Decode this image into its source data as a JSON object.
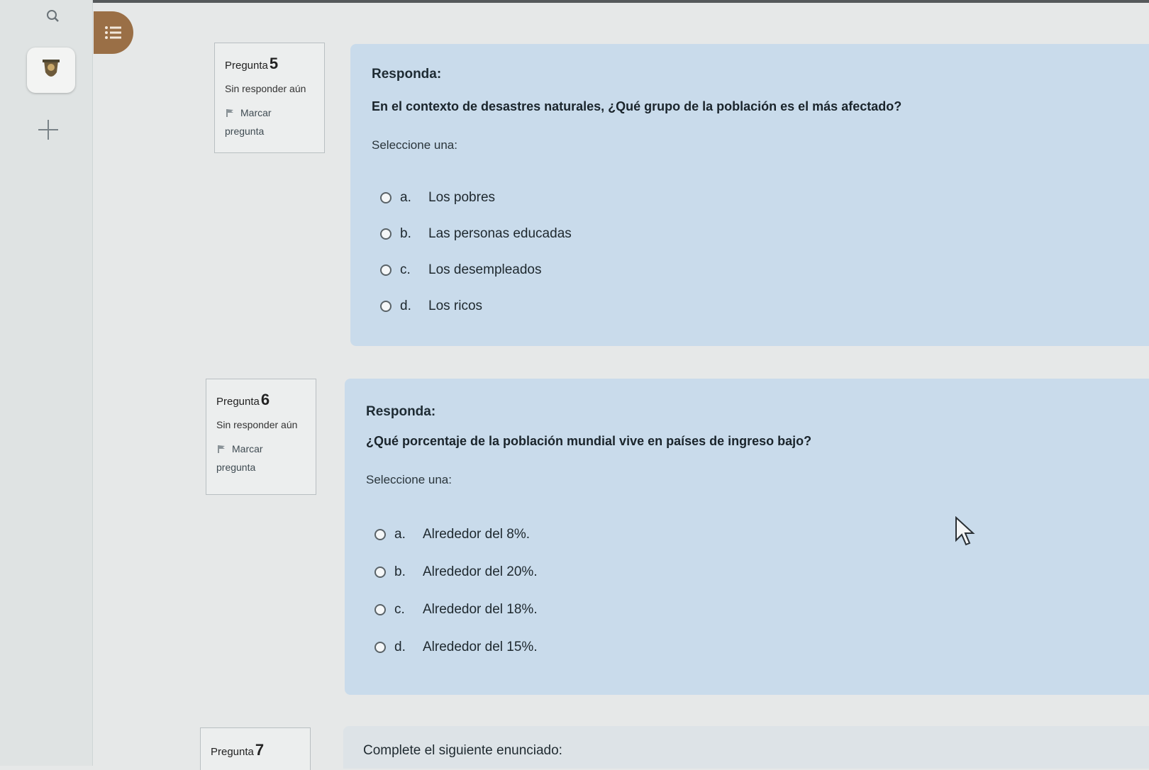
{
  "window": {
    "accent_color": "#9a6f46",
    "question_bg": "#c9dbeb"
  },
  "rail": {
    "search_icon": "search-icon",
    "logo_icon": "seal-icon",
    "add_icon": "plus-icon"
  },
  "menu": {
    "icon": "list-icon"
  },
  "questions": [
    {
      "label": "Pregunta",
      "number": "5",
      "status": "Sin responder aún",
      "flag_line1": "Marcar",
      "flag_line2": "pregunta",
      "responda": "Responda:",
      "text": "En el contexto de desastres naturales, ¿Qué grupo de la población es el más afectado?",
      "select_label": "Seleccione una:",
      "options": [
        {
          "letter": "a.",
          "text": "Los pobres"
        },
        {
          "letter": "b.",
          "text": "Las personas educadas"
        },
        {
          "letter": "c.",
          "text": "Los desempleados"
        },
        {
          "letter": "d.",
          "text": "Los ricos"
        }
      ]
    },
    {
      "label": "Pregunta",
      "number": "6",
      "status": "Sin responder aún",
      "flag_line1": "Marcar",
      "flag_line2": "pregunta",
      "responda": "Responda:",
      "text": "¿Qué porcentaje de la población mundial vive en países de ingreso bajo?",
      "select_label": "Seleccione una:",
      "options": [
        {
          "letter": "a.",
          "text": "Alrededor del 8%."
        },
        {
          "letter": "b.",
          "text": "Alrededor del 20%."
        },
        {
          "letter": "c.",
          "text": "Alrededor del 18%."
        },
        {
          "letter": "d.",
          "text": "Alrededor del 15%."
        }
      ]
    },
    {
      "label": "Pregunta",
      "number": "7",
      "text": "Complete el siguiente enunciado:"
    }
  ]
}
